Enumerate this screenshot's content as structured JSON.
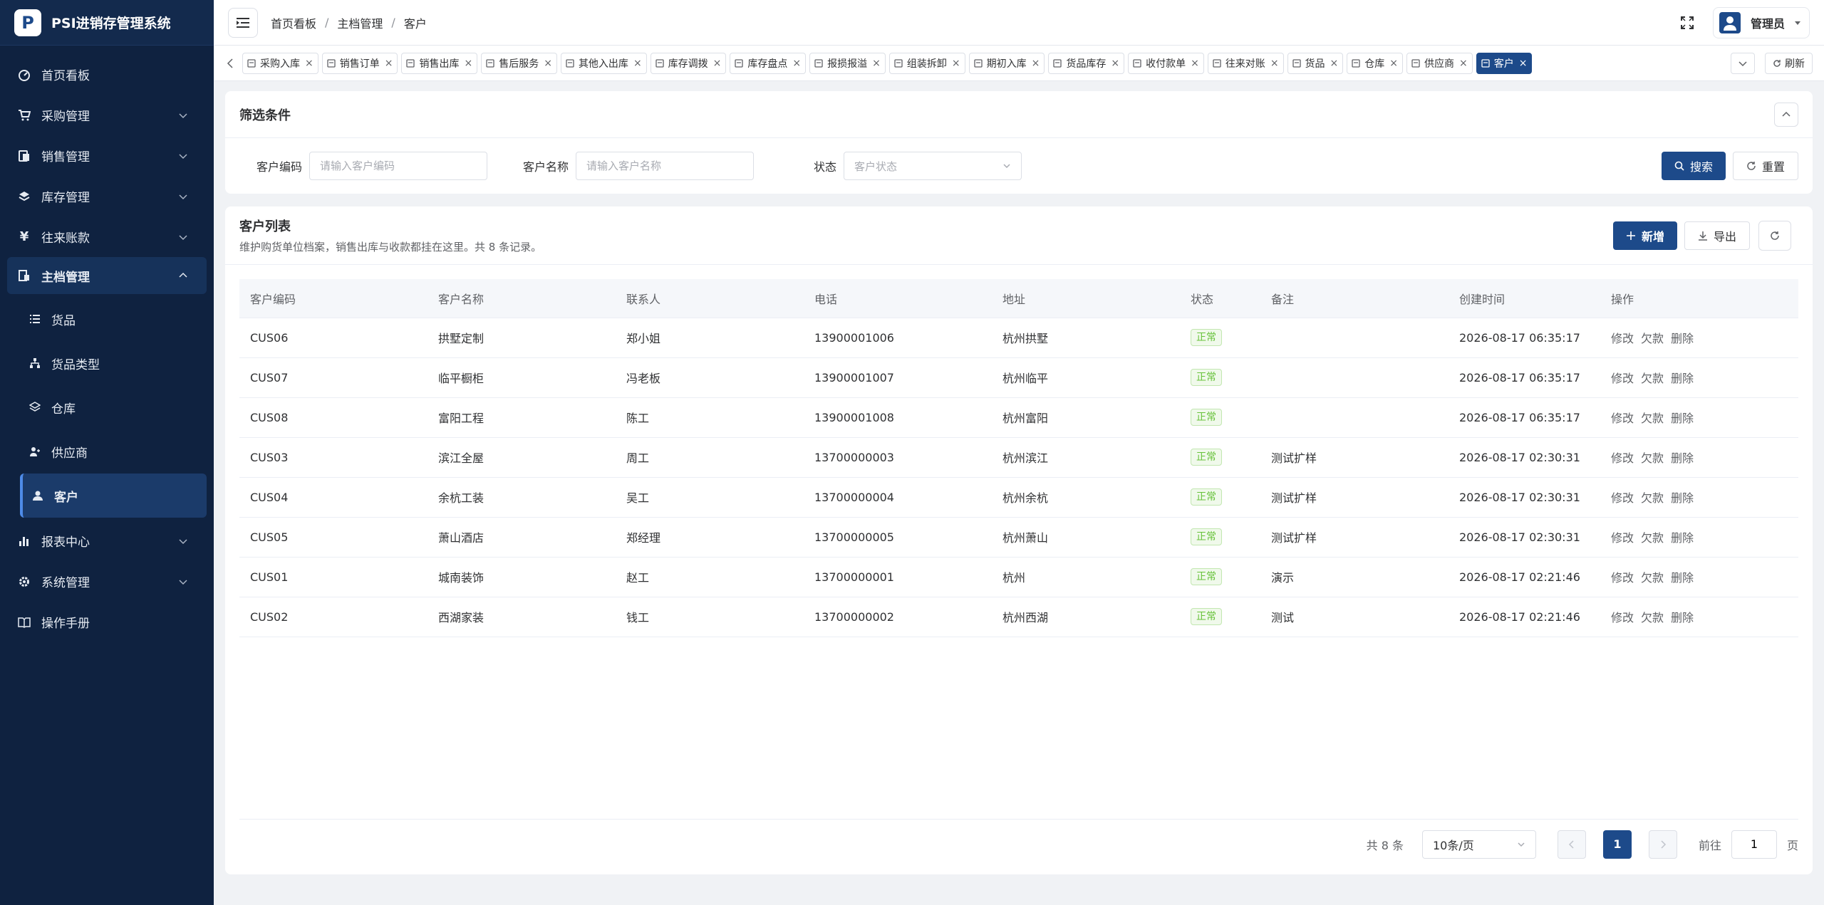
{
  "app": {
    "logo_letter": "P",
    "title": "PSI进销存管理系统"
  },
  "sidebar": {
    "items": [
      {
        "label": "首页看板",
        "icon": "dashboard-icon"
      },
      {
        "label": "采购管理",
        "icon": "cart-icon"
      },
      {
        "label": "销售管理",
        "icon": "sales-icon"
      },
      {
        "label": "库存管理",
        "icon": "inventory-icon"
      },
      {
        "label": "往来账款",
        "icon": "yen-icon"
      },
      {
        "label": "主档管理",
        "icon": "master-icon"
      },
      {
        "label": "报表中心",
        "icon": "chart-icon"
      },
      {
        "label": "系统管理",
        "icon": "gear-icon"
      },
      {
        "label": "操作手册",
        "icon": "book-icon"
      }
    ],
    "submenu": [
      {
        "label": "货品",
        "icon": "list-icon"
      },
      {
        "label": "货品类型",
        "icon": "tree-icon"
      },
      {
        "label": "仓库",
        "icon": "layers-icon"
      },
      {
        "label": "供应商",
        "icon": "supplier-icon"
      },
      {
        "label": "客户",
        "icon": "user-icon"
      }
    ]
  },
  "header": {
    "breadcrumb": [
      "首页看板",
      "主档管理",
      "客户"
    ],
    "separator": "/",
    "user": "管理员"
  },
  "tabs": [
    {
      "label": "采购入库"
    },
    {
      "label": "销售订单"
    },
    {
      "label": "销售出库"
    },
    {
      "label": "售后服务"
    },
    {
      "label": "其他入出库"
    },
    {
      "label": "库存调拨"
    },
    {
      "label": "库存盘点"
    },
    {
      "label": "报损报溢"
    },
    {
      "label": "组装拆卸"
    },
    {
      "label": "期初入库"
    },
    {
      "label": "货品库存"
    },
    {
      "label": "收付款单"
    },
    {
      "label": "往来对账"
    },
    {
      "label": "货品"
    },
    {
      "label": "仓库"
    },
    {
      "label": "供应商"
    },
    {
      "label": "客户",
      "active": true
    }
  ],
  "tabs_tools": {
    "refresh": "刷新"
  },
  "filter": {
    "title": "筛选条件",
    "code_label": "客户编码",
    "code_placeholder": "请输入客户编码",
    "name_label": "客户名称",
    "name_placeholder": "请输入客户名称",
    "status_label": "状态",
    "status_placeholder": "客户状态",
    "search": "搜索",
    "reset": "重置"
  },
  "list": {
    "title": "客户列表",
    "subtitle": "维护购货单位档案，销售出库与收款都挂在这里。共 8 条记录。",
    "add": "新增",
    "export": "导出",
    "columns": [
      "客户编码",
      "客户名称",
      "联系人",
      "电话",
      "地址",
      "状态",
      "备注",
      "创建时间",
      "操作"
    ],
    "ops": [
      "修改",
      "欠款",
      "删除"
    ],
    "rows": [
      {
        "code": "CUS06",
        "name": "拱墅定制",
        "contact": "郑小姐",
        "phone": "13900001006",
        "address": "杭州拱墅",
        "status": "正常",
        "remark": "",
        "created": "2026-08-17 06:35:17"
      },
      {
        "code": "CUS07",
        "name": "临平橱柜",
        "contact": "冯老板",
        "phone": "13900001007",
        "address": "杭州临平",
        "status": "正常",
        "remark": "",
        "created": "2026-08-17 06:35:17"
      },
      {
        "code": "CUS08",
        "name": "富阳工程",
        "contact": "陈工",
        "phone": "13900001008",
        "address": "杭州富阳",
        "status": "正常",
        "remark": "",
        "created": "2026-08-17 06:35:17"
      },
      {
        "code": "CUS03",
        "name": "滨江全屋",
        "contact": "周工",
        "phone": "13700000003",
        "address": "杭州滨江",
        "status": "正常",
        "remark": "测试扩样",
        "created": "2026-08-17 02:30:31"
      },
      {
        "code": "CUS04",
        "name": "余杭工装",
        "contact": "吴工",
        "phone": "13700000004",
        "address": "杭州余杭",
        "status": "正常",
        "remark": "测试扩样",
        "created": "2026-08-17 02:30:31"
      },
      {
        "code": "CUS05",
        "name": "萧山酒店",
        "contact": "郑经理",
        "phone": "13700000005",
        "address": "杭州萧山",
        "status": "正常",
        "remark": "测试扩样",
        "created": "2026-08-17 02:30:31"
      },
      {
        "code": "CUS01",
        "name": "城南装饰",
        "contact": "赵工",
        "phone": "13700000001",
        "address": "杭州",
        "status": "正常",
        "remark": "演示",
        "created": "2026-08-17 02:21:46"
      },
      {
        "code": "CUS02",
        "name": "西湖家装",
        "contact": "钱工",
        "phone": "13700000002",
        "address": "杭州西湖",
        "status": "正常",
        "remark": "测试",
        "created": "2026-08-17 02:21:46"
      }
    ]
  },
  "pager": {
    "total": "共 8 条",
    "page_size": "10条/页",
    "current": "1",
    "goto_label": "前往",
    "goto_value": "1",
    "page_suffix": "页"
  },
  "colors": {
    "primary": "#1d4a8a",
    "sidebar": "#0f2240",
    "success": "#67c23a"
  }
}
